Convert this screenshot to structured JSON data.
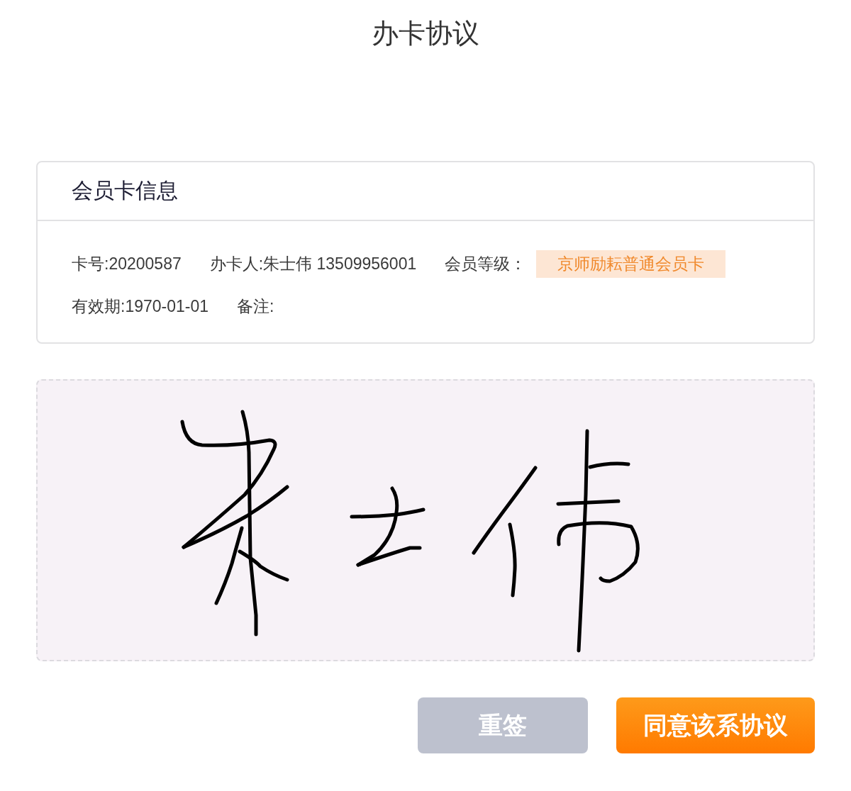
{
  "page": {
    "title": "办卡协议"
  },
  "card": {
    "title": "会员卡信息",
    "rows": [
      [
        {
          "kind": "text",
          "text": "卡号:20200587"
        },
        {
          "kind": "text",
          "text": "办卡人:朱士伟 13509956001"
        },
        {
          "kind": "tag",
          "label": "会员等级：",
          "value": "京师励耘普通会员卡"
        }
      ],
      [
        {
          "kind": "text",
          "text": "有效期:1970-01-01"
        },
        {
          "kind": "text",
          "text": "备注:"
        }
      ]
    ]
  },
  "buttons": [
    {
      "kind": "secondary",
      "label": "重签"
    },
    {
      "kind": "primary",
      "label": "同意该系协议"
    }
  ]
}
